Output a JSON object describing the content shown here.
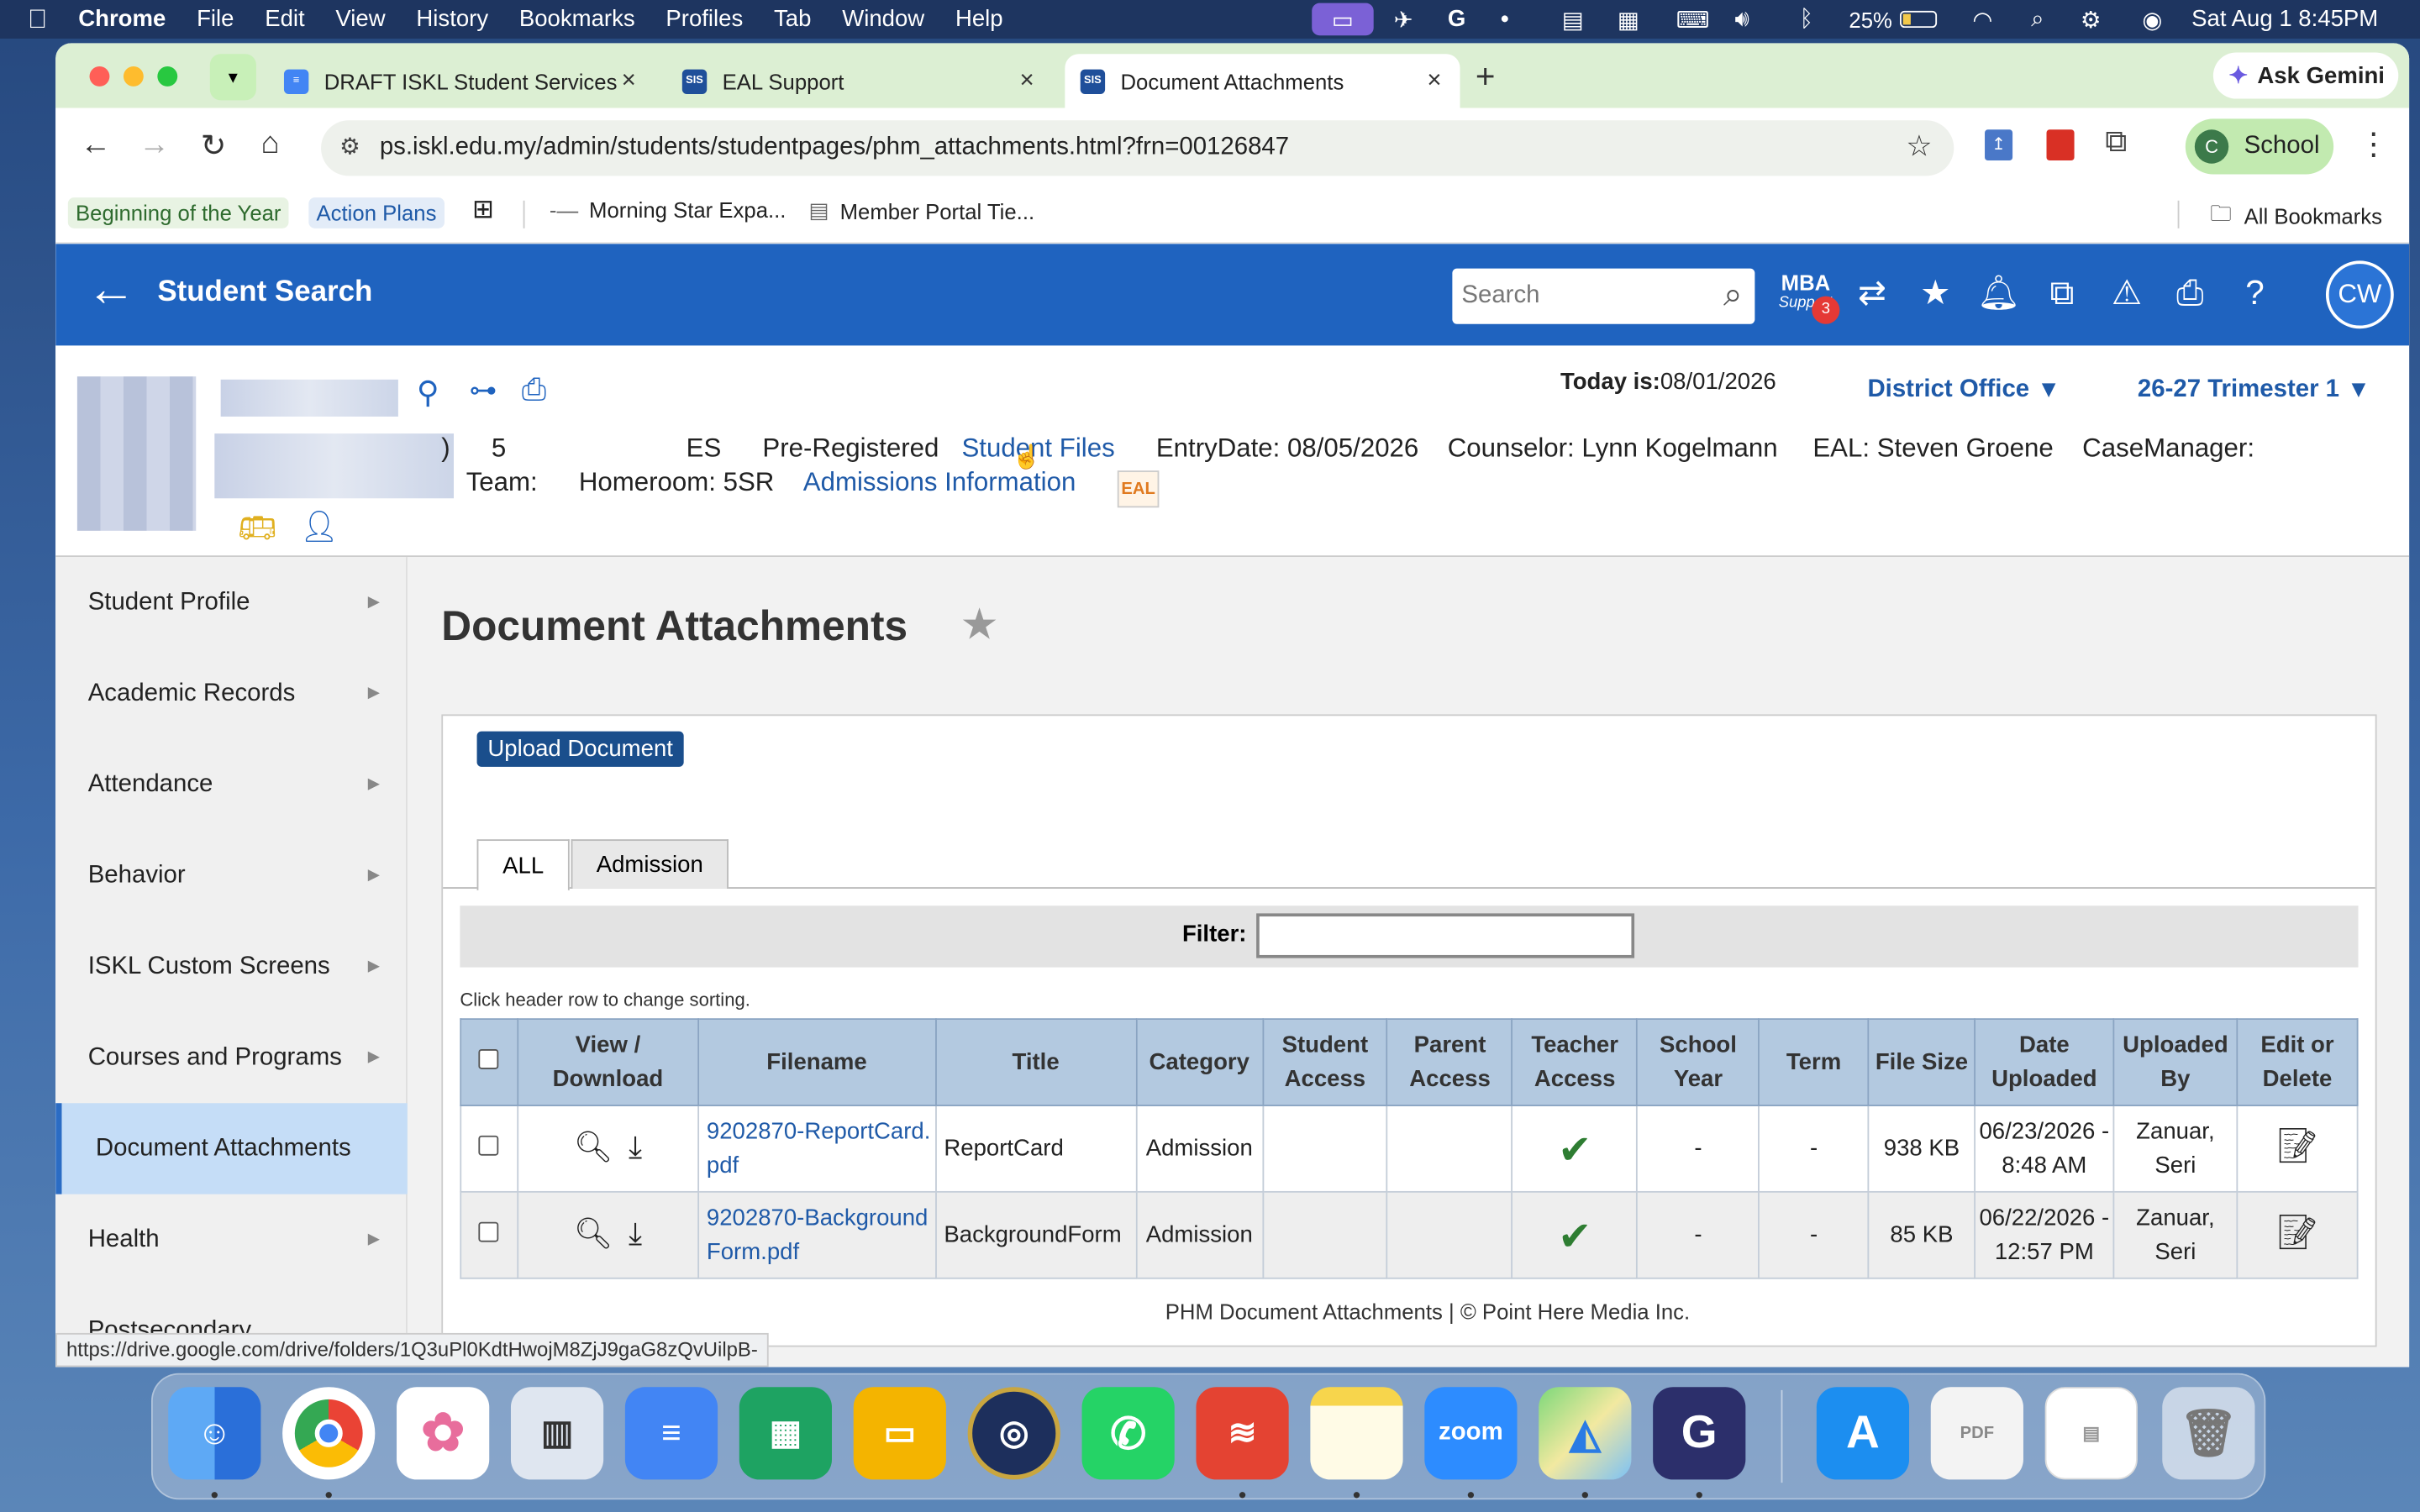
{
  "menubar": {
    "app_name": "Chrome",
    "items": [
      "File",
      "Edit",
      "View",
      "History",
      "Bookmarks",
      "Profiles",
      "Tab",
      "Window",
      "Help"
    ],
    "battery": "25%",
    "datetime": "Sat Aug 1  8:45PM"
  },
  "browser": {
    "tabs": [
      {
        "title": "DRAFT ISKL Student Services"
      },
      {
        "title": "EAL Support"
      },
      {
        "title": "Document Attachments"
      }
    ],
    "ask_gemini": "Ask Gemini",
    "url": "ps.iskl.edu.my/admin/students/studentpages/phm_attachments.html?frn=00126847",
    "profile_label": "School",
    "profile_initial": "C",
    "bookmarks": [
      {
        "label": "Beginning of the Year",
        "color": "#2e6b2e",
        "bg": "#e8f3e3"
      },
      {
        "label": "Action Plans",
        "color": "#1f5aa8",
        "bg": "#e3ecf8"
      },
      {
        "label": "Morning Star Expa..."
      },
      {
        "label": "Member Portal Tie..."
      }
    ],
    "all_bookmarks": "All Bookmarks"
  },
  "app": {
    "title": "Student Search",
    "search_placeholder": "Search",
    "mba_label": "MBA",
    "mba_sub": "Support",
    "mba_badge": "3",
    "user_initials": "CW"
  },
  "student": {
    "today_label": "Today is:",
    "today_value": "08/01/2026",
    "office": "District Office",
    "term": "26-27 Trimester 1",
    "grade_prefix": ")",
    "grade": "5",
    "school": "ES",
    "status": "Pre-Registered",
    "student_files": "Student Files",
    "entry_date": "EntryDate: 08/05/2026",
    "counselor": "Counselor: Lynn Kogelmann",
    "eal": "EAL: Steven Groene",
    "case_manager": "CaseManager:",
    "team": "Team:",
    "homeroom": "Homeroom: 5SR",
    "admissions_info": "Admissions Information",
    "eal_badge": "EAL"
  },
  "sidebar": {
    "items": [
      {
        "label": "Student Profile"
      },
      {
        "label": "Academic Records"
      },
      {
        "label": "Attendance"
      },
      {
        "label": "Behavior"
      },
      {
        "label": "ISKL Custom Screens"
      },
      {
        "label": "Courses and Programs"
      },
      {
        "label": "Document Attachments"
      },
      {
        "label": "Health"
      },
      {
        "label": "Postsecondary"
      }
    ]
  },
  "main": {
    "page_title": "Document Attachments",
    "upload_button": "Upload Document",
    "tabs": [
      "ALL",
      "Admission"
    ],
    "filter_label": "Filter:",
    "sort_hint": "Click header row to change sorting.",
    "columns": [
      "View / Download",
      "Filename",
      "Title",
      "Category",
      "Student Access",
      "Parent Access",
      "Teacher Access",
      "School Year",
      "Term",
      "File Size",
      "Date Uploaded",
      "Uploaded By",
      "Edit or Delete"
    ],
    "rows": [
      {
        "filename": "9202870-ReportCard.pdf",
        "title": "ReportCard",
        "category": "Admission",
        "student_access": "",
        "parent_access": "",
        "teacher_access": "✔",
        "school_year": "-",
        "term": "-",
        "file_size": "938 KB",
        "date_uploaded": "06/23/2026 - 8:48 AM",
        "uploaded_by": "Zanuar, Seri"
      },
      {
        "filename": "9202870-BackgroundForm.pdf",
        "title": "BackgroundForm",
        "category": "Admission",
        "student_access": "",
        "parent_access": "",
        "teacher_access": "✔",
        "school_year": "-",
        "term": "-",
        "file_size": "85 KB",
        "date_uploaded": "06/22/2026 - 12:57 PM",
        "uploaded_by": "Zanuar, Seri"
      }
    ],
    "footer": "PHM Document Attachments | © Point Here Media Inc."
  },
  "status_url": "https://drive.google.com/drive/folders/1Q3uPl0KdtHwojM8ZjJ9gaG8zQvUilpB-",
  "colors": {
    "accent": "#1f63bf",
    "check": "#2e7d32"
  },
  "dock": {
    "apps": [
      "finder-icon",
      "chrome-icon",
      "photos-icon",
      "keynote-icon",
      "docs-icon",
      "sheets-icon",
      "slides-icon",
      "iskl-icon",
      "whatsapp-icon",
      "todoist-icon",
      "notes-icon",
      "zoom-icon",
      "maps-icon",
      "goodnotes-icon",
      "appstore-icon",
      "pdf-doc-icon",
      "screenshot-doc-icon",
      "trash-icon"
    ],
    "zoom_label": "zoom"
  }
}
